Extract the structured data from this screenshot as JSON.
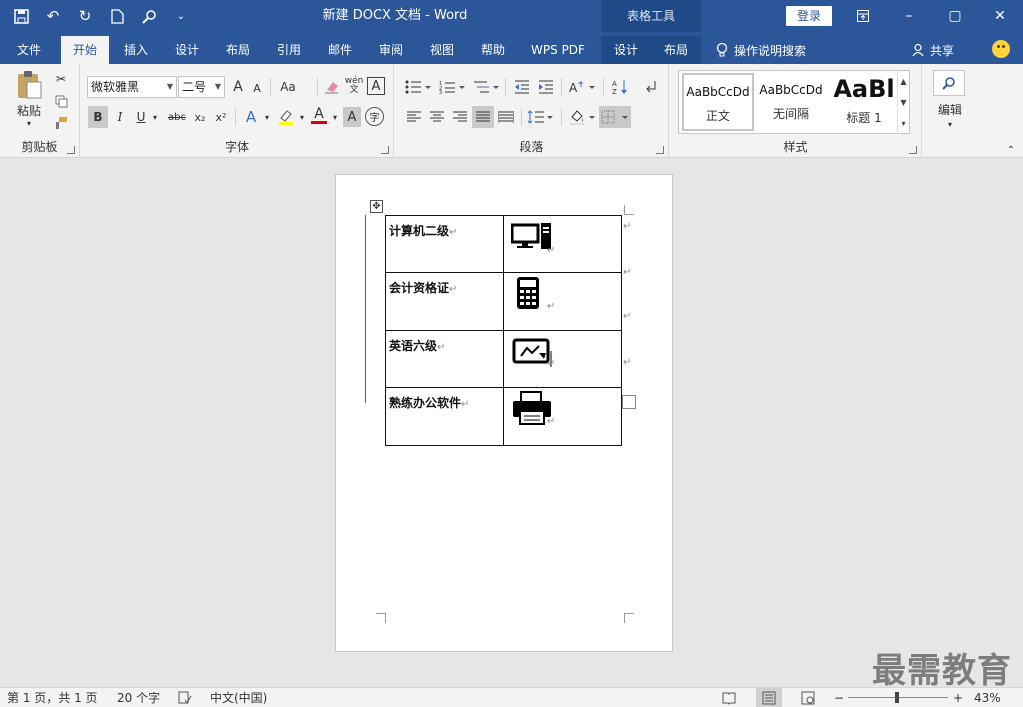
{
  "window": {
    "title": "新建 DOCX 文档 - Word",
    "context_tab_group": "表格工具",
    "login_label": "登录",
    "minimize": "–",
    "restore": "▢",
    "close": "✕"
  },
  "tabs": [
    {
      "label": "文件"
    },
    {
      "label": "开始"
    },
    {
      "label": "插入"
    },
    {
      "label": "设计"
    },
    {
      "label": "布局"
    },
    {
      "label": "引用"
    },
    {
      "label": "邮件"
    },
    {
      "label": "审阅"
    },
    {
      "label": "视图"
    },
    {
      "label": "帮助"
    },
    {
      "label": "WPS PDF"
    },
    {
      "label": "设计"
    },
    {
      "label": "布局"
    }
  ],
  "tell_me": "操作说明搜索",
  "share": "共享",
  "ribbon": {
    "clipboard": {
      "label": "剪贴板",
      "paste": "粘贴"
    },
    "font": {
      "label": "字体",
      "font_name": "微软雅黑",
      "font_size": "二号",
      "grow": "A",
      "shrink": "A",
      "case": "Aa",
      "phonetic": "wén",
      "border_char": "A",
      "bold": "B",
      "italic": "I",
      "underline": "U",
      "strike": "abc",
      "subscript": "x₂",
      "superscript": "x²",
      "effects": "A",
      "font_color": "A",
      "shade": "A",
      "enclose": "字"
    },
    "paragraph": {
      "label": "段落"
    },
    "styles": {
      "label": "样式",
      "items": [
        {
          "sample": "AaBbCcDd",
          "name": "正文"
        },
        {
          "sample": "AaBbCcDd",
          "name": "无间隔"
        },
        {
          "sample": "AaBl",
          "name": "标题 1"
        }
      ]
    },
    "editing": {
      "label": "编辑"
    }
  },
  "document": {
    "rows": [
      {
        "text": "计算机二级",
        "icon": "computer-icon"
      },
      {
        "text": "会计资格证",
        "icon": "calculator-icon"
      },
      {
        "text": "英语六级",
        "icon": "certificate-icon"
      },
      {
        "text": "熟练办公软件",
        "icon": "printer-icon"
      }
    ],
    "para_mark": "↵"
  },
  "watermark": "最需教育",
  "status": {
    "page": "第 1 页，共 1 页",
    "words": "20 个字",
    "language": "中文(中国)",
    "zoom": "43%",
    "zoom_minus": "−",
    "zoom_plus": "+"
  },
  "colors": {
    "accent": "#2b579a",
    "context_tab": "#1e4a87",
    "highlight": "#ffff00",
    "font_color": "#e00000"
  }
}
